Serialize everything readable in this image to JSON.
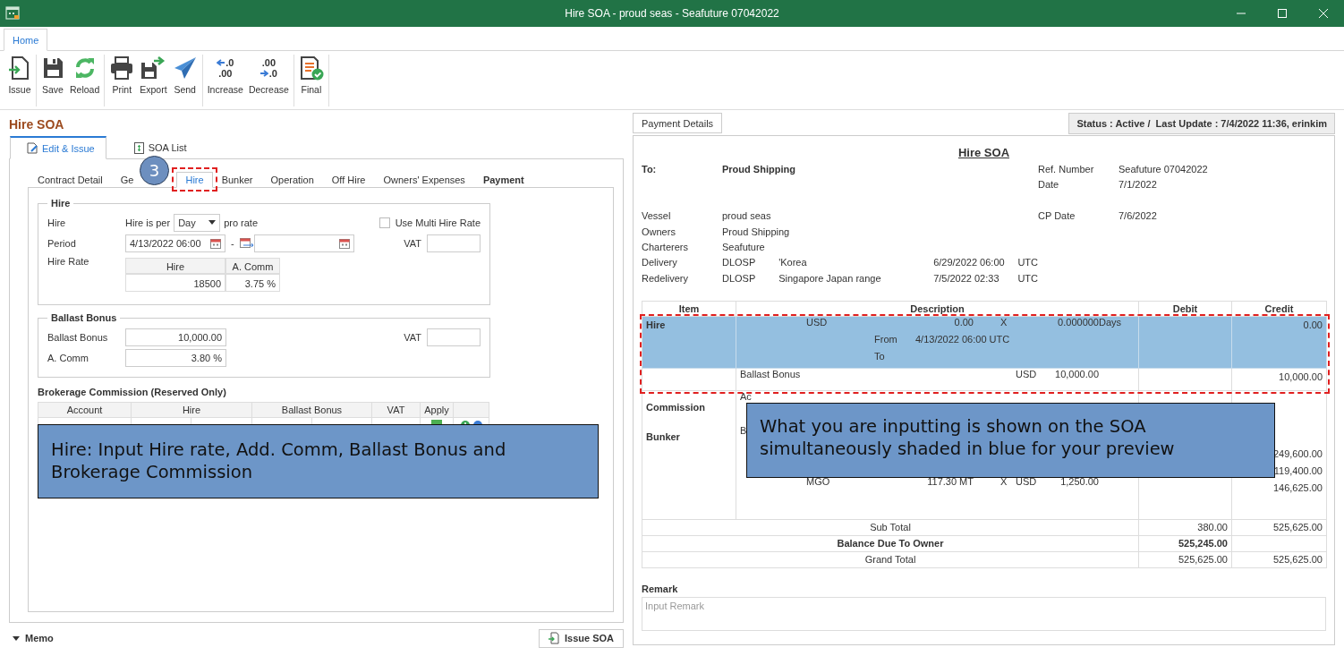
{
  "window": {
    "title": "Hire SOA - proud seas - Seafuture 07042022"
  },
  "ribbon": {
    "tabs": [
      {
        "label": "Home",
        "selected": true
      }
    ],
    "groups": [
      [
        {
          "label": "Issue"
        }
      ],
      [
        {
          "label": "Save"
        },
        {
          "label": "Reload"
        }
      ],
      [
        {
          "label": "Print"
        },
        {
          "label": "Export"
        },
        {
          "label": "Send"
        }
      ],
      [
        {
          "label": "Increase",
          "icon_text": [
            ".0",
            ".00"
          ]
        },
        {
          "label": "Decrease",
          "icon_text": [
            ".00",
            ".0"
          ]
        }
      ],
      [
        {
          "label": "Final"
        }
      ]
    ]
  },
  "left": {
    "title": "Hire SOA",
    "tabs": [
      {
        "label": "Edit & Issue",
        "selected": true
      },
      {
        "label": "SOA List",
        "selected": false
      }
    ],
    "step_badge": "3",
    "subtabs": [
      {
        "label": "Contract Detail",
        "selected": false,
        "emphasized": false,
        "annotated": false
      },
      {
        "label": "Ge",
        "selected": false,
        "emphasized": false,
        "annotated": false
      },
      {
        "label": "Hire",
        "selected": true,
        "emphasized": false,
        "annotated": true
      },
      {
        "label": "Bunker",
        "selected": false,
        "emphasized": false,
        "annotated": false
      },
      {
        "label": "Operation",
        "selected": false,
        "emphasized": false,
        "annotated": false
      },
      {
        "label": "Off Hire",
        "selected": false,
        "emphasized": false,
        "annotated": false
      },
      {
        "label": "Owners' Expenses",
        "selected": false,
        "emphasized": false,
        "annotated": false
      },
      {
        "label": "Payment",
        "selected": false,
        "emphasized": true,
        "annotated": false
      }
    ],
    "hire": {
      "title": "Hire",
      "hire_label": "Hire",
      "per_label": "Hire is per",
      "per_value": "Day",
      "pro_rate": "pro rate",
      "multi_rate": {
        "label": "Use Multi Hire Rate",
        "checked": false
      },
      "period_label": "Period",
      "period_from": "4/13/2022 06:00",
      "period_sep": "-",
      "vat_label": "VAT",
      "rate_label": "Hire Rate",
      "rate_columns": [
        "Hire",
        "A. Comm"
      ],
      "rate_values": [
        "18500",
        "3.75 %"
      ]
    },
    "ballast": {
      "title": "Ballast Bonus",
      "vat_label": "VAT",
      "fields": [
        {
          "label": "Ballast Bonus",
          "value": "10,000.00"
        },
        {
          "label": "A. Comm",
          "value": "3.80 %"
        }
      ]
    },
    "brokerage": {
      "title": "Brokerage Commission (Reserved Only)",
      "columns": [
        "Account",
        "Hire",
        "Ballast Bonus",
        "VAT",
        "Apply"
      ],
      "rows": [
        {
          "kind": "entry",
          "apply": true
        },
        {
          "kind": "blank"
        }
      ]
    },
    "memo": "Memo",
    "issue_button": "Issue SOA",
    "callout": "Hire: Input Hire rate, Add. Comm, Ballast Bonus and Brokerage Commission"
  },
  "right": {
    "payment_button": "Payment Details",
    "status": "Status : Active /  Last Update : 7/4/2022 11:36, erinkim",
    "doc": {
      "title": "Hire SOA",
      "to_label": "To:",
      "to": "Proud Shipping",
      "refs": [
        {
          "label": "Ref. Number",
          "value": "Seafuture 07042022"
        },
        {
          "label": "Date",
          "value": "7/1/2022"
        }
      ],
      "cp": {
        "label": "CP Date",
        "value": "7/6/2022"
      },
      "details": [
        {
          "label": "Vessel",
          "value": "proud seas"
        },
        {
          "label": "Owners",
          "value": "Proud Shipping"
        },
        {
          "label": "Charterers",
          "value": "Seafuture"
        },
        {
          "label": "Delivery",
          "value": "DLOSP",
          "place": "'Korea",
          "time": "6/29/2022 06:00",
          "zone": "UTC"
        },
        {
          "label": "Redelivery",
          "value": "DLOSP",
          "place": "Singapore Japan range",
          "time": "7/5/2022 02:33",
          "zone": "UTC"
        }
      ],
      "columns": [
        "Item",
        "Description",
        "Debit",
        "Credit"
      ],
      "rows": [
        {
          "kind": "hire",
          "item": "Hire",
          "highlighted": true,
          "currency": "USD",
          "amount": "0.00",
          "times": "X",
          "rate": "0.000000",
          "unit": "Days",
          "from_label": "From",
          "from": "4/13/2022 06:00 UTC",
          "to_label": "To",
          "credit": "0.00"
        },
        {
          "kind": "ballast",
          "highlighted": false,
          "label": "Ballast Bonus",
          "currency": "USD",
          "amount": "10,000.00",
          "credit": "10,000.00"
        },
        {
          "kind": "commission",
          "item": "Commission",
          "highlighted": false,
          "label": "Ac"
        },
        {
          "kind": "bunker",
          "item": "Bunker",
          "highlighted": false,
          "label": "B",
          "lines": [
            {
              "credit": "249,600.00"
            },
            {
              "credit": "119,400.00"
            },
            {
              "grade": "MGO",
              "qty": "117.30 MT",
              "times": "X",
              "currency": "USD",
              "price": "1,250.00",
              "credit": "146,625.00"
            }
          ]
        }
      ],
      "totals": [
        {
          "label": "Sub Total",
          "bold": false,
          "debit": "380.00",
          "credit": "525,625.00"
        },
        {
          "label": "Balance Due To Owner",
          "bold": true,
          "debit": "525,245.00"
        },
        {
          "label": "Grand Total",
          "bold": false,
          "debit": "525,625.00",
          "credit": "525,625.00"
        }
      ],
      "remark_label": "Remark",
      "remark_placeholder": "Input Remark"
    },
    "callout": "What you are inputting is shown on the SOA simultaneously shaded in blue for your preview"
  }
}
